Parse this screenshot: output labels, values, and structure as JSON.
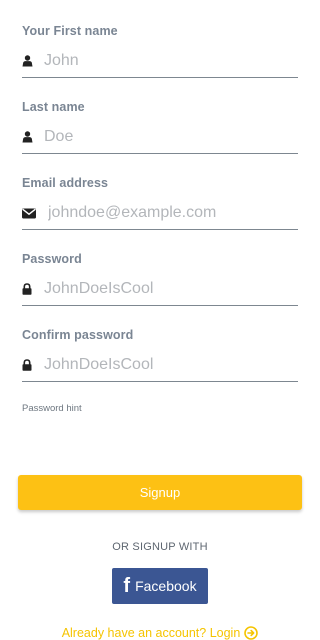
{
  "form": {
    "fields": [
      {
        "label": "Your First name",
        "value": "John",
        "icon": "user-icon"
      },
      {
        "label": "Last name",
        "value": "Doe",
        "icon": "user-icon"
      },
      {
        "label": "Email address",
        "value": "johndoe@example.com",
        "icon": "envelope-icon"
      },
      {
        "label": "Password",
        "value": "JohnDoeIsCool",
        "icon": "lock-icon"
      },
      {
        "label": "Confirm password",
        "value": "JohnDoeIsCool",
        "icon": "lock-icon"
      }
    ],
    "password_hint": "Password hint"
  },
  "actions": {
    "signup_label": "Signup",
    "or_text": "OR SIGNUP WITH",
    "facebook_label": "Facebook",
    "login_text": "Already have an account? Login"
  },
  "colors": {
    "accent": "#fdc114",
    "facebook": "#3b5693",
    "label": "#7a8593",
    "placeholder": "#b3b6ba",
    "link": "#f5c400"
  }
}
